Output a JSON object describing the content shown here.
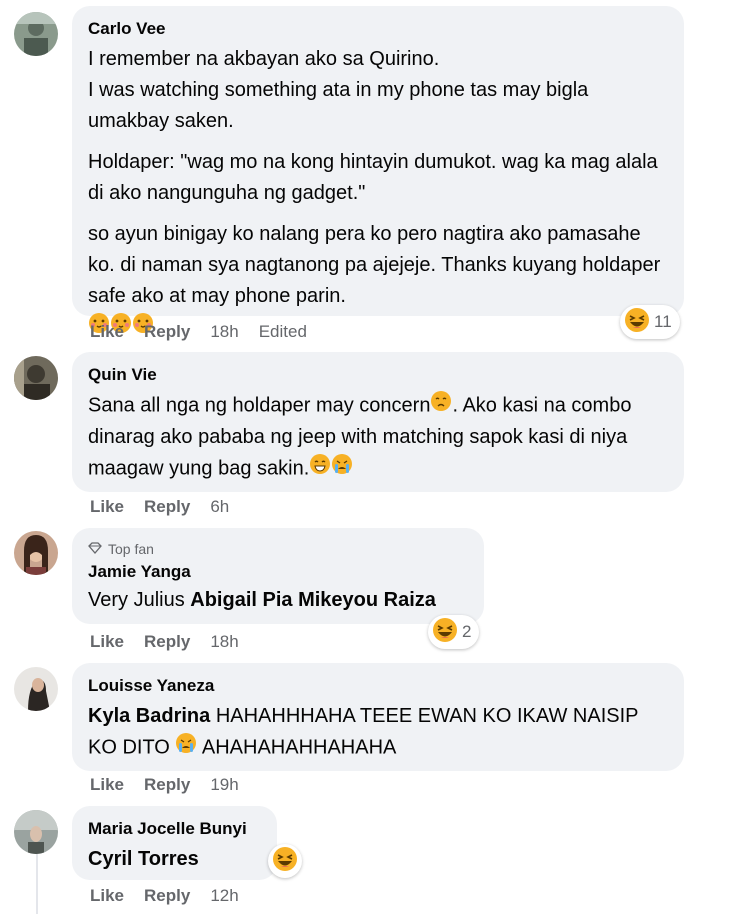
{
  "comments": [
    {
      "author": "Carlo Vee",
      "paragraphs": [
        "I remember na akbayan ako sa Quirino.\nI was watching something ata in my phone tas may bigla umakbay saken.",
        "Holdaper: \"wag mo na kong hintayin dumukot. wag ka mag alala di ako nangunguha ng gadget.\"",
        "so ayun binigay ko nalang pera ko pero nagtira ako pamasahe ko. di naman sya nagtanong pa ajejeje. Thanks kuyang holdaper safe ako at may phone parin."
      ],
      "actions": {
        "like": "Like",
        "reply": "Reply",
        "time": "18h",
        "edited": "Edited"
      },
      "reaction_count": "11",
      "reaction_icon": "laughing-emoji"
    },
    {
      "author": "Quin Vie",
      "text_a": "Sana all nga ng holdaper may concern",
      "text_b": ". Ako kasi na combo dinarag ako pababa ng jeep with matching sapok kasi di niya maagaw yung bag sakin.",
      "actions": {
        "like": "Like",
        "reply": "Reply",
        "time": "6h"
      }
    },
    {
      "badge": "Top fan",
      "author": "Jamie Yanga",
      "text_plain": "Very Julius ",
      "mentions": "Abigail Pia Mikeyou Raiza",
      "actions": {
        "like": "Like",
        "reply": "Reply",
        "time": "18h"
      },
      "reaction_count": "2",
      "reaction_icon": "laughing-emoji"
    },
    {
      "author": "Louisse Yaneza",
      "mention": "Kyla Badrina",
      "text_a": " HAHAHHHAHA TEEE EWAN KO IKAW NAISIP KO DITO ",
      "text_b": " AHAHAHAHHAHAHA",
      "actions": {
        "like": "Like",
        "reply": "Reply",
        "time": "19h"
      }
    },
    {
      "author": "Maria Jocelle Bunyi",
      "mention": "Cyril Torres",
      "actions": {
        "like": "Like",
        "reply": "Reply",
        "time": "12h"
      },
      "reaction_icon": "laughing-emoji"
    }
  ],
  "colors": {
    "bubble": "#f0f2f5",
    "secondary_text": "#65676b",
    "emoji_yellow": "#f7b125"
  }
}
